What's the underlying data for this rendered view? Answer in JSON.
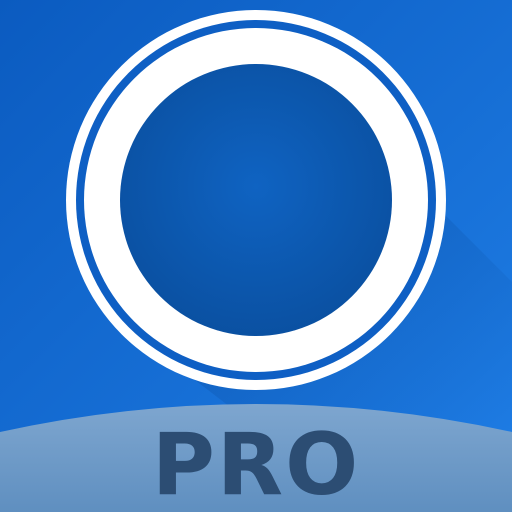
{
  "icon": {
    "name": "ring-logo-icon",
    "badge_text": "PRO",
    "colors": {
      "background_top": "#0b5bc0",
      "background_bottom": "#1f7ee6",
      "ring": "#ffffff",
      "inner_disc": "#0c58b2",
      "bottom_band": "#6a98c6",
      "badge_text": "#2c4d73"
    }
  }
}
